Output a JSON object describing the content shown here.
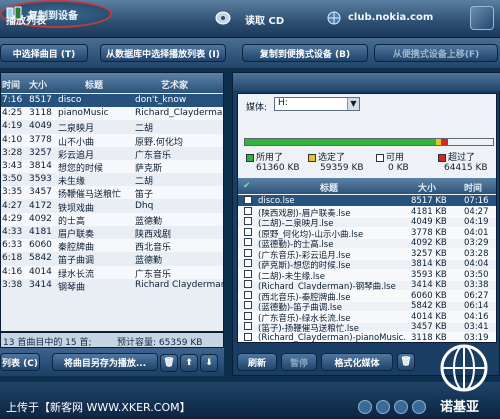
{
  "topbar": {
    "left_label": "播放列表",
    "copy_to_device": "复制到设备",
    "read_cd": "读取 CD",
    "club_nokia": "club.nokia.com"
  },
  "toolbar2": {
    "choose_from_list": "中选择曲目 (T)",
    "choose_from_library": "从数据库中选择播放列表 (I)",
    "copy_to_portable": "复制到便携式设备 (B)",
    "remove_from_portable": "从便携式设备上移(F)"
  },
  "left_list": {
    "headers": {
      "time": "时间",
      "size": "大小",
      "title": "标题",
      "artist": "艺术家"
    },
    "rows": [
      {
        "time": "7:16",
        "size": "8517",
        "title": "disco",
        "artist": "don't_know"
      },
      {
        "time": "4:25",
        "size": "3118",
        "title": "pianoMusic",
        "artist": "Richard_Clayderman"
      },
      {
        "time": "4:19",
        "size": "4049",
        "title": "二泉映月",
        "artist": "二胡"
      },
      {
        "time": "4:10",
        "size": "3778",
        "title": "山不小曲",
        "artist": "原野.何化均"
      },
      {
        "time": "3:28",
        "size": "3257",
        "title": "彩云追月",
        "artist": "广东音乐"
      },
      {
        "time": "3:43",
        "size": "3814",
        "title": "想您的时候",
        "artist": "萨克斯"
      },
      {
        "time": "3:50",
        "size": "3593",
        "title": "未生缘",
        "artist": "二胡"
      },
      {
        "time": "3:35",
        "size": "3457",
        "title": "扬鞭催马送粮忙",
        "artist": "笛子"
      },
      {
        "time": "4:27",
        "size": "4172",
        "title": "铁坝戏曲",
        "artist": "Dhq"
      },
      {
        "time": "4:29",
        "size": "4092",
        "title": "的士高",
        "artist": "蓝德勤"
      },
      {
        "time": "4:33",
        "size": "4181",
        "title": "眉户联奏",
        "artist": "陕西戏剧"
      },
      {
        "time": "6:33",
        "size": "6060",
        "title": "秦腔牌曲",
        "artist": "西北音乐"
      },
      {
        "time": "6:18",
        "size": "5842",
        "title": "笛子曲调",
        "artist": "蓝德勤"
      },
      {
        "time": "4:16",
        "size": "4014",
        "title": "绿水长流",
        "artist": "广东音乐"
      },
      {
        "time": "3:38",
        "size": "3414",
        "title": "钢琴曲",
        "artist": "Richard Clayderman"
      }
    ],
    "status": "13 首曲目中的 15 首;",
    "estimate": "预计容量: 65359 KB"
  },
  "left_buttons": {
    "lx": "列表 (C)",
    "save_as": "将曲目另存为播放..."
  },
  "right_panel": {
    "media_label": "媒体:",
    "media_value": "H:",
    "capacity": {
      "used_fraction": 0.77,
      "selected_fraction": 0.02,
      "over_fraction": 0.03
    },
    "legend": {
      "used": "所用了",
      "selected": "选定了",
      "free": "可用",
      "over": "超过了"
    },
    "values": {
      "used": "61360 KB",
      "selected": "59359 KB",
      "free": "0 KB",
      "over": "64415 KB"
    },
    "headers": {
      "title": "标题",
      "size": "大小",
      "time": "时间"
    },
    "rows": [
      {
        "title": "disco.lse",
        "size": "8517 KB",
        "time": "07:16"
      },
      {
        "title": "(陕西戏剧)-眉户联奏.lse",
        "size": "4181 KB",
        "time": "04:27"
      },
      {
        "title": "(二胡)-二泉映月.lse",
        "size": "4049 KB",
        "time": "04:19"
      },
      {
        "title": "(原野_何化均)-山示小曲.lse",
        "size": "3778 KB",
        "time": "04:01"
      },
      {
        "title": "(蓝德勤)-的士高.lse",
        "size": "4092 KB",
        "time": "03:29"
      },
      {
        "title": "(广东音乐)-彩云追月.lse",
        "size": "3257 KB",
        "time": "03:28"
      },
      {
        "title": "(萨克斯)-想您的时候.lse",
        "size": "3814 KB",
        "time": "04:04"
      },
      {
        "title": "(二胡)-未生缘.lse",
        "size": "3593 KB",
        "time": "03:50"
      },
      {
        "title": "(Richard_Clayderman)-钢琴曲.lse",
        "size": "3414 KB",
        "time": "03:38"
      },
      {
        "title": "(西北音乐)-秦腔牌曲.lse",
        "size": "6060 KB",
        "time": "06:27"
      },
      {
        "title": "(蓝德勤)-笛子曲调.lse",
        "size": "5842 KB",
        "time": "06:14"
      },
      {
        "title": "(广东音乐)-绿水长流.lse",
        "size": "4014 KB",
        "time": "04:16"
      },
      {
        "title": "(笛子)-扬鞭催马送粮忙.lse",
        "size": "3457 KB",
        "time": "03:41"
      },
      {
        "title": "(Richard_Clayderman)-pianoMusic.",
        "size": "3118 KB",
        "time": "03:19"
      }
    ],
    "buttons": {
      "refresh": "刷新",
      "pause": "暂停",
      "format": "格式化媒体"
    }
  },
  "footer": {
    "uploader": "上传于【新客网 WWW.XKER.COM】",
    "brand": "诺基亚"
  }
}
